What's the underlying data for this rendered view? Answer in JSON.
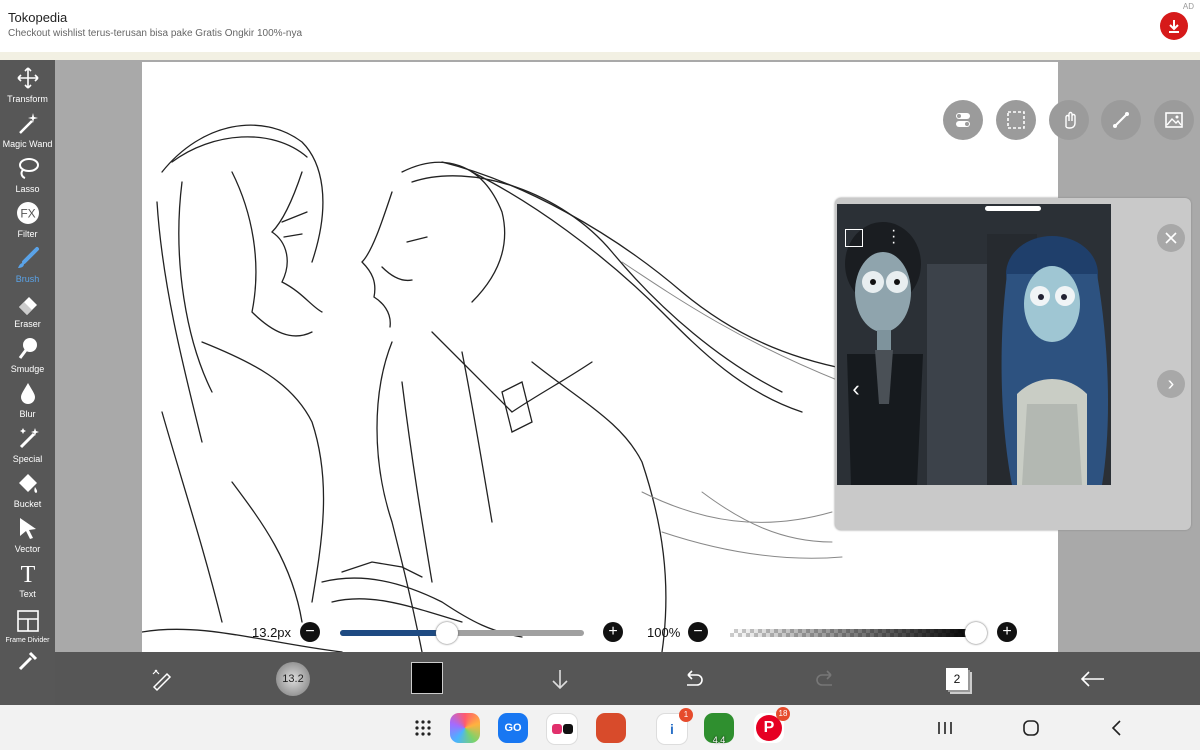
{
  "ad": {
    "title": "Tokopedia",
    "subtitle": "Checkout wishlist terus-terusan bisa pake Gratis Ongkir 100%-nya",
    "tag": "AD"
  },
  "tools": [
    {
      "label": "Transform",
      "icon": "transform-icon"
    },
    {
      "label": "Magic Wand",
      "icon": "magic-wand-icon"
    },
    {
      "label": "Lasso",
      "icon": "lasso-icon"
    },
    {
      "label": "Filter",
      "icon": "fx-icon"
    },
    {
      "label": "Brush",
      "icon": "brush-icon"
    },
    {
      "label": "Eraser",
      "icon": "eraser-icon"
    },
    {
      "label": "Smudge",
      "icon": "smudge-icon"
    },
    {
      "label": "Blur",
      "icon": "blur-drop-icon"
    },
    {
      "label": "Special",
      "icon": "special-icon"
    },
    {
      "label": "Bucket",
      "icon": "bucket-icon"
    },
    {
      "label": "Vector",
      "icon": "vector-cursor-icon"
    },
    {
      "label": "Text",
      "icon": "text-icon"
    },
    {
      "label": "Frame Divider",
      "icon": "frame-divider-icon"
    }
  ],
  "fx_text": "FX",
  "text_tool_glyph": "T",
  "brush": {
    "size_label": "13.2px",
    "size_level": 0.44,
    "opacity_label": "100%",
    "opacity_level": 1.0,
    "preview_value": "13.2"
  },
  "colors": {
    "accent": "#5aa3e8",
    "slider_fill": "#1e4a82",
    "current_color": "#000000",
    "toolbar_bg": "#575757"
  },
  "layers_count": "2",
  "dock_badges": {
    "ibis": "1",
    "game": "4.4",
    "pinterest": "18"
  },
  "go_label": "GO"
}
